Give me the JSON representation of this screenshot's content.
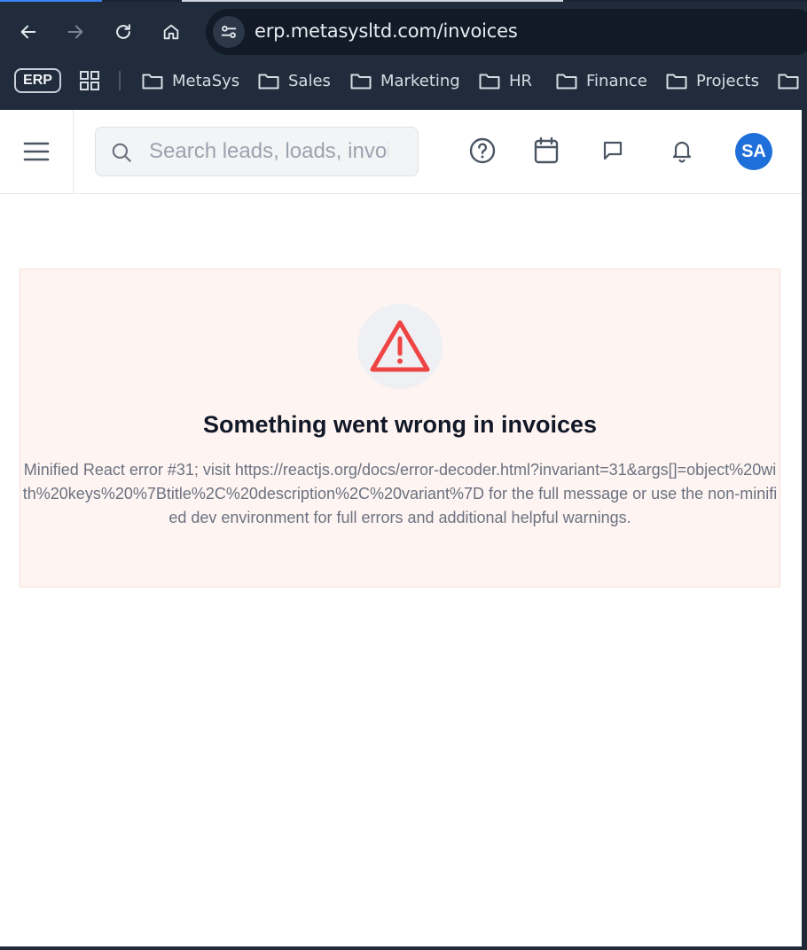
{
  "browser": {
    "url": "erp.metasysltd.com/invoices",
    "bookmarks": {
      "erp_chip": "ERP",
      "items": [
        {
          "label": "MetaSys"
        },
        {
          "label": "Sales"
        },
        {
          "label": "Marketing"
        },
        {
          "label": "HR"
        },
        {
          "label": "Finance"
        },
        {
          "label": "Projects"
        }
      ]
    }
  },
  "header": {
    "search_placeholder": "Search leads, loads, invoices",
    "avatar_initials": "SA",
    "avatar_color": "#1e6fd9"
  },
  "error": {
    "title": "Something went wrong in invoices",
    "message": "Minified React error #31; visit https://reactjs.org/docs/error-decoder.html?invariant=31&args[]=object%20with%20keys%20%7Btitle%2C%20description%2C%20variant%7D for the full message or use the non-minified dev environment for full errors and additional helpful warnings.",
    "accent_color": "#ef4444"
  }
}
